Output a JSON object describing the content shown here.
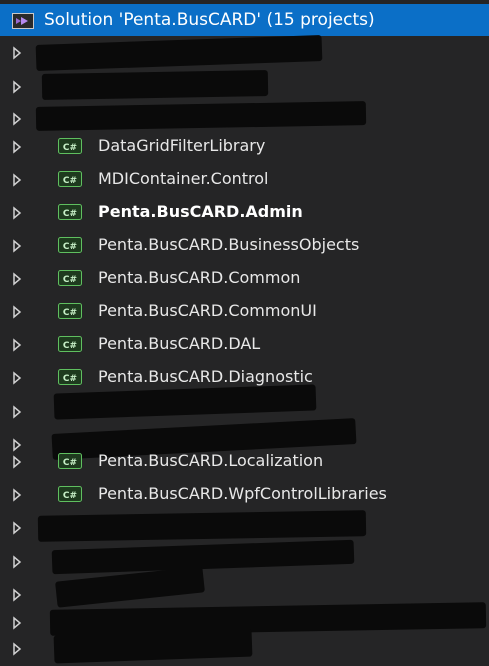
{
  "solution": {
    "title": "Solution 'Penta.BusCARD' (15 projects)"
  },
  "projects": [
    {
      "label": "DataGridFilterLibrary",
      "bold": false
    },
    {
      "label": "MDIContainer.Control",
      "bold": false
    },
    {
      "label": "Penta.BusCARD.Admin",
      "bold": true
    },
    {
      "label": "Penta.BusCARD.BusinessObjects",
      "bold": false
    },
    {
      "label": "Penta.BusCARD.Common",
      "bold": false
    },
    {
      "label": "Penta.BusCARD.CommonUI",
      "bold": false
    },
    {
      "label": "Penta.BusCARD.DAL",
      "bold": false
    },
    {
      "label": "Penta.BusCARD.Diagnostic",
      "bold": false
    },
    {
      "label": "Penta.BusCARD.Localization",
      "bold": false
    },
    {
      "label": "Penta.BusCARD.WpfControlLibraries",
      "bold": false
    }
  ],
  "icons": {
    "solution": "visual-studio-solution-icon",
    "project": "csharp-project-icon",
    "expander": "collapsed-triangle-icon"
  },
  "colors": {
    "background": "#252526",
    "selection": "#0b6fc7",
    "text": "#e8e8e8"
  }
}
